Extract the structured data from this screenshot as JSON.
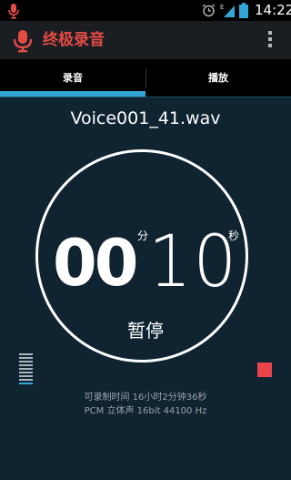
{
  "status_bar": {
    "time": "14:22",
    "icons": [
      "mic-notification-icon",
      "alarm-icon",
      "signal-icon",
      "battery-icon"
    ]
  },
  "action_bar": {
    "title": "终极录音",
    "title_color": "#e54b46",
    "icons": [
      "mic-icon",
      "overflow-menu-icon"
    ]
  },
  "tabs": [
    {
      "label": "录音",
      "selected": true
    },
    {
      "label": "播放",
      "selected": false
    }
  ],
  "accent_color": "#33a6d6",
  "recording": {
    "file_name": "Voice001_41.wav",
    "minutes": "00",
    "minutes_unit": "分",
    "seconds": "10",
    "seconds_unit": "秒",
    "state_label": "暂停",
    "level_meter_bars_active": 1,
    "level_meter_bars_total": 9,
    "stop_color": "#e8444a"
  },
  "info": {
    "remaining": "可录制时间 16小时2分钟36秒",
    "format": "PCM 立体声 16bit 44100 Hz"
  }
}
